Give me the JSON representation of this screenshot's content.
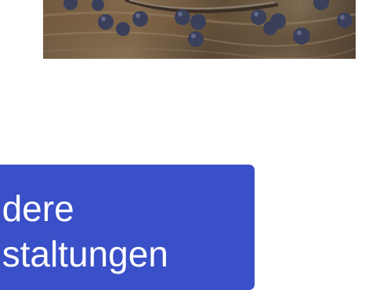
{
  "hero_image": {
    "icon": "blueberry-cake-photo"
  },
  "category_card": {
    "line1": "ndere",
    "line2": "nstaltungen",
    "background_color": "#3a50c8",
    "text_color": "#ffffff"
  }
}
